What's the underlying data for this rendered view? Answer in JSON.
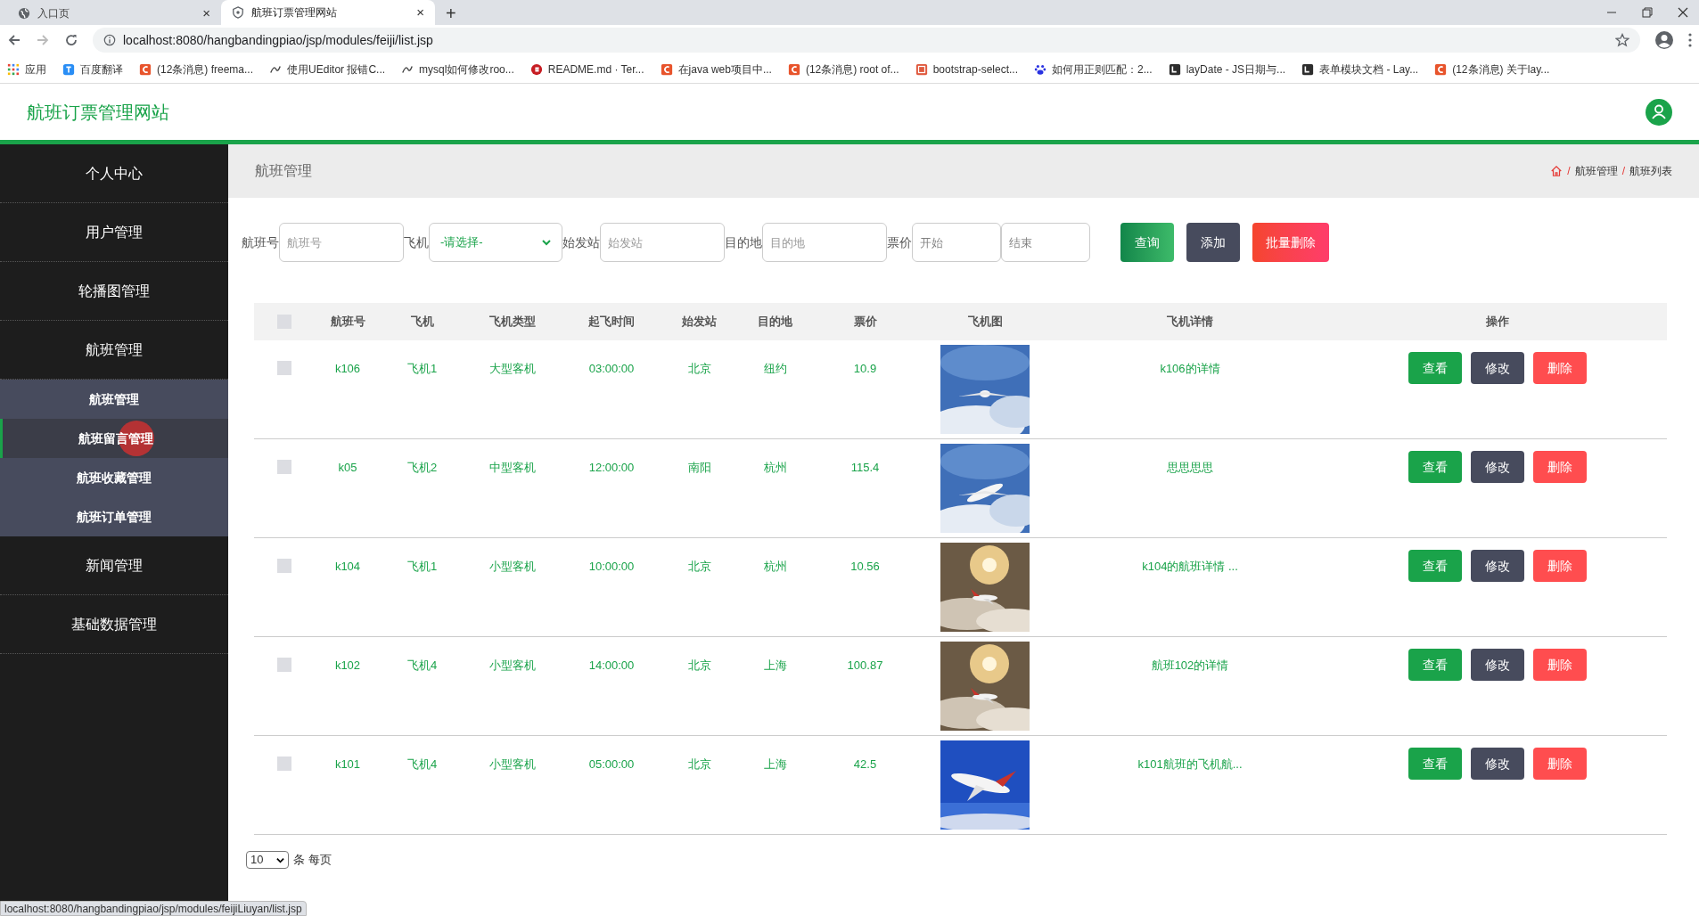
{
  "browser": {
    "tabs": [
      {
        "title": "入口页",
        "close": "×",
        "selected": false
      },
      {
        "title": "航班订票管理网站",
        "close": "×",
        "selected": true
      }
    ],
    "new_tab": "+",
    "url_host": "localhost",
    "url_rest": ":8080/hangbandingpiao/jsp/modules/feiji/list.jsp",
    "bookmarks": [
      {
        "label": "应用",
        "kind": "apps"
      },
      {
        "label": "百度翻译",
        "kind": "blue"
      },
      {
        "label": "(12条消息) freema...",
        "kind": "red"
      },
      {
        "label": "使用UEditor 报错C...",
        "kind": "line"
      },
      {
        "label": "mysql如何修改roo...",
        "kind": "line"
      },
      {
        "label": "README.md · Ter...",
        "kind": "gitee"
      },
      {
        "label": "在java web项目中...",
        "kind": "red"
      },
      {
        "label": "(12条消息) root of...",
        "kind": "red"
      },
      {
        "label": "bootstrap-select...",
        "kind": "jian"
      },
      {
        "label": "如何用正则匹配：2...",
        "kind": "paw"
      },
      {
        "label": "layDate - JS日期与...",
        "kind": "dark"
      },
      {
        "label": "表单模块文档 - Lay...",
        "kind": "dark"
      },
      {
        "label": "(12条消息) 关于lay...",
        "kind": "red"
      }
    ],
    "status_url": "localhost:8080/hangbandingpiao/jsp/modules/feijiLiuyan/list.jsp"
  },
  "app": {
    "title": "航班订票管理网站"
  },
  "sidebar": {
    "items": [
      {
        "label": "个人中心"
      },
      {
        "label": "用户管理"
      },
      {
        "label": "轮播图管理"
      },
      {
        "label": "航班管理",
        "children": [
          {
            "label": "航班管理",
            "selected": false
          },
          {
            "label": "航班留言管理",
            "selected": true
          },
          {
            "label": "航班收藏管理",
            "selected": false
          },
          {
            "label": "航班订单管理",
            "selected": false
          }
        ]
      },
      {
        "label": "新闻管理"
      },
      {
        "label": "基础数据管理"
      }
    ]
  },
  "page": {
    "title": "航班管理",
    "breadcrumb": [
      {
        "separator": "/",
        "label": "航班管理"
      },
      {
        "separator": "/",
        "label": "航班列表"
      }
    ]
  },
  "filters": [
    {
      "label": "航班号",
      "kind": "input",
      "placeholder": "航班号"
    },
    {
      "label": "飞机",
      "kind": "select",
      "value": "-请选择-"
    },
    {
      "label": "始发站",
      "kind": "input",
      "placeholder": "始发站"
    },
    {
      "label": "目的地",
      "kind": "input",
      "placeholder": "目的地"
    },
    {
      "label": "票价",
      "kind": "range",
      "placeholder": "开始",
      "placeholder_end": "结束"
    }
  ],
  "actions": [
    {
      "label": "查询",
      "kind": "search"
    },
    {
      "label": "添加",
      "kind": "add"
    },
    {
      "label": "批量删除",
      "kind": "delete"
    }
  ],
  "table": {
    "all_checked": false,
    "columns": [
      "航班号",
      "飞机",
      "飞机类型",
      "起飞时间",
      "始发站",
      "目的地",
      "票价",
      "飞机图",
      "飞机详情",
      "操作"
    ],
    "rows": [
      {
        "checked": false,
        "cells": [
          "k106",
          "飞机1",
          "大型客机",
          "03:00:00",
          "北京",
          "纽约",
          "10.9"
        ],
        "detail": "k106的详情"
      },
      {
        "checked": false,
        "cells": [
          "k05",
          "飞机2",
          "中型客机",
          "12:00:00",
          "南阳",
          "杭州",
          "115.4"
        ],
        "detail": "思思思思"
      },
      {
        "checked": false,
        "cells": [
          "k104",
          "飞机1",
          "小型客机",
          "10:00:00",
          "北京",
          "杭州",
          "10.56"
        ],
        "detail": "k104的航班详情 ..."
      },
      {
        "checked": false,
        "cells": [
          "k102",
          "飞机4",
          "小型客机",
          "14:00:00",
          "北京",
          "上海",
          "100.87"
        ],
        "detail": "航班102的详情"
      },
      {
        "checked": false,
        "cells": [
          "k101",
          "飞机4",
          "小型客机",
          "05:00:00",
          "北京",
          "上海",
          "42.5"
        ],
        "detail": "k101航班的飞机航..."
      }
    ],
    "row_actions": [
      [
        {
          "label": "查看",
          "kind": "view"
        },
        {
          "label": "修改",
          "kind": "edit"
        },
        {
          "label": "删除",
          "kind": "delete"
        }
      ],
      [
        {
          "label": "查看",
          "kind": "view"
        },
        {
          "label": "修改",
          "kind": "edit"
        },
        {
          "label": "删除",
          "kind": "delete"
        }
      ],
      [
        {
          "label": "查看",
          "kind": "view"
        },
        {
          "label": "修改",
          "kind": "edit"
        },
        {
          "label": "删除",
          "kind": "delete"
        }
      ],
      [
        {
          "label": "查看",
          "kind": "view"
        },
        {
          "label": "修改",
          "kind": "edit"
        },
        {
          "label": "删除",
          "kind": "delete"
        }
      ],
      [
        {
          "label": "查看",
          "kind": "view"
        },
        {
          "label": "修改",
          "kind": "edit"
        },
        {
          "label": "删除",
          "kind": "delete"
        }
      ]
    ]
  },
  "pagination": {
    "page_size": "10",
    "suffix": "条 每页"
  }
}
